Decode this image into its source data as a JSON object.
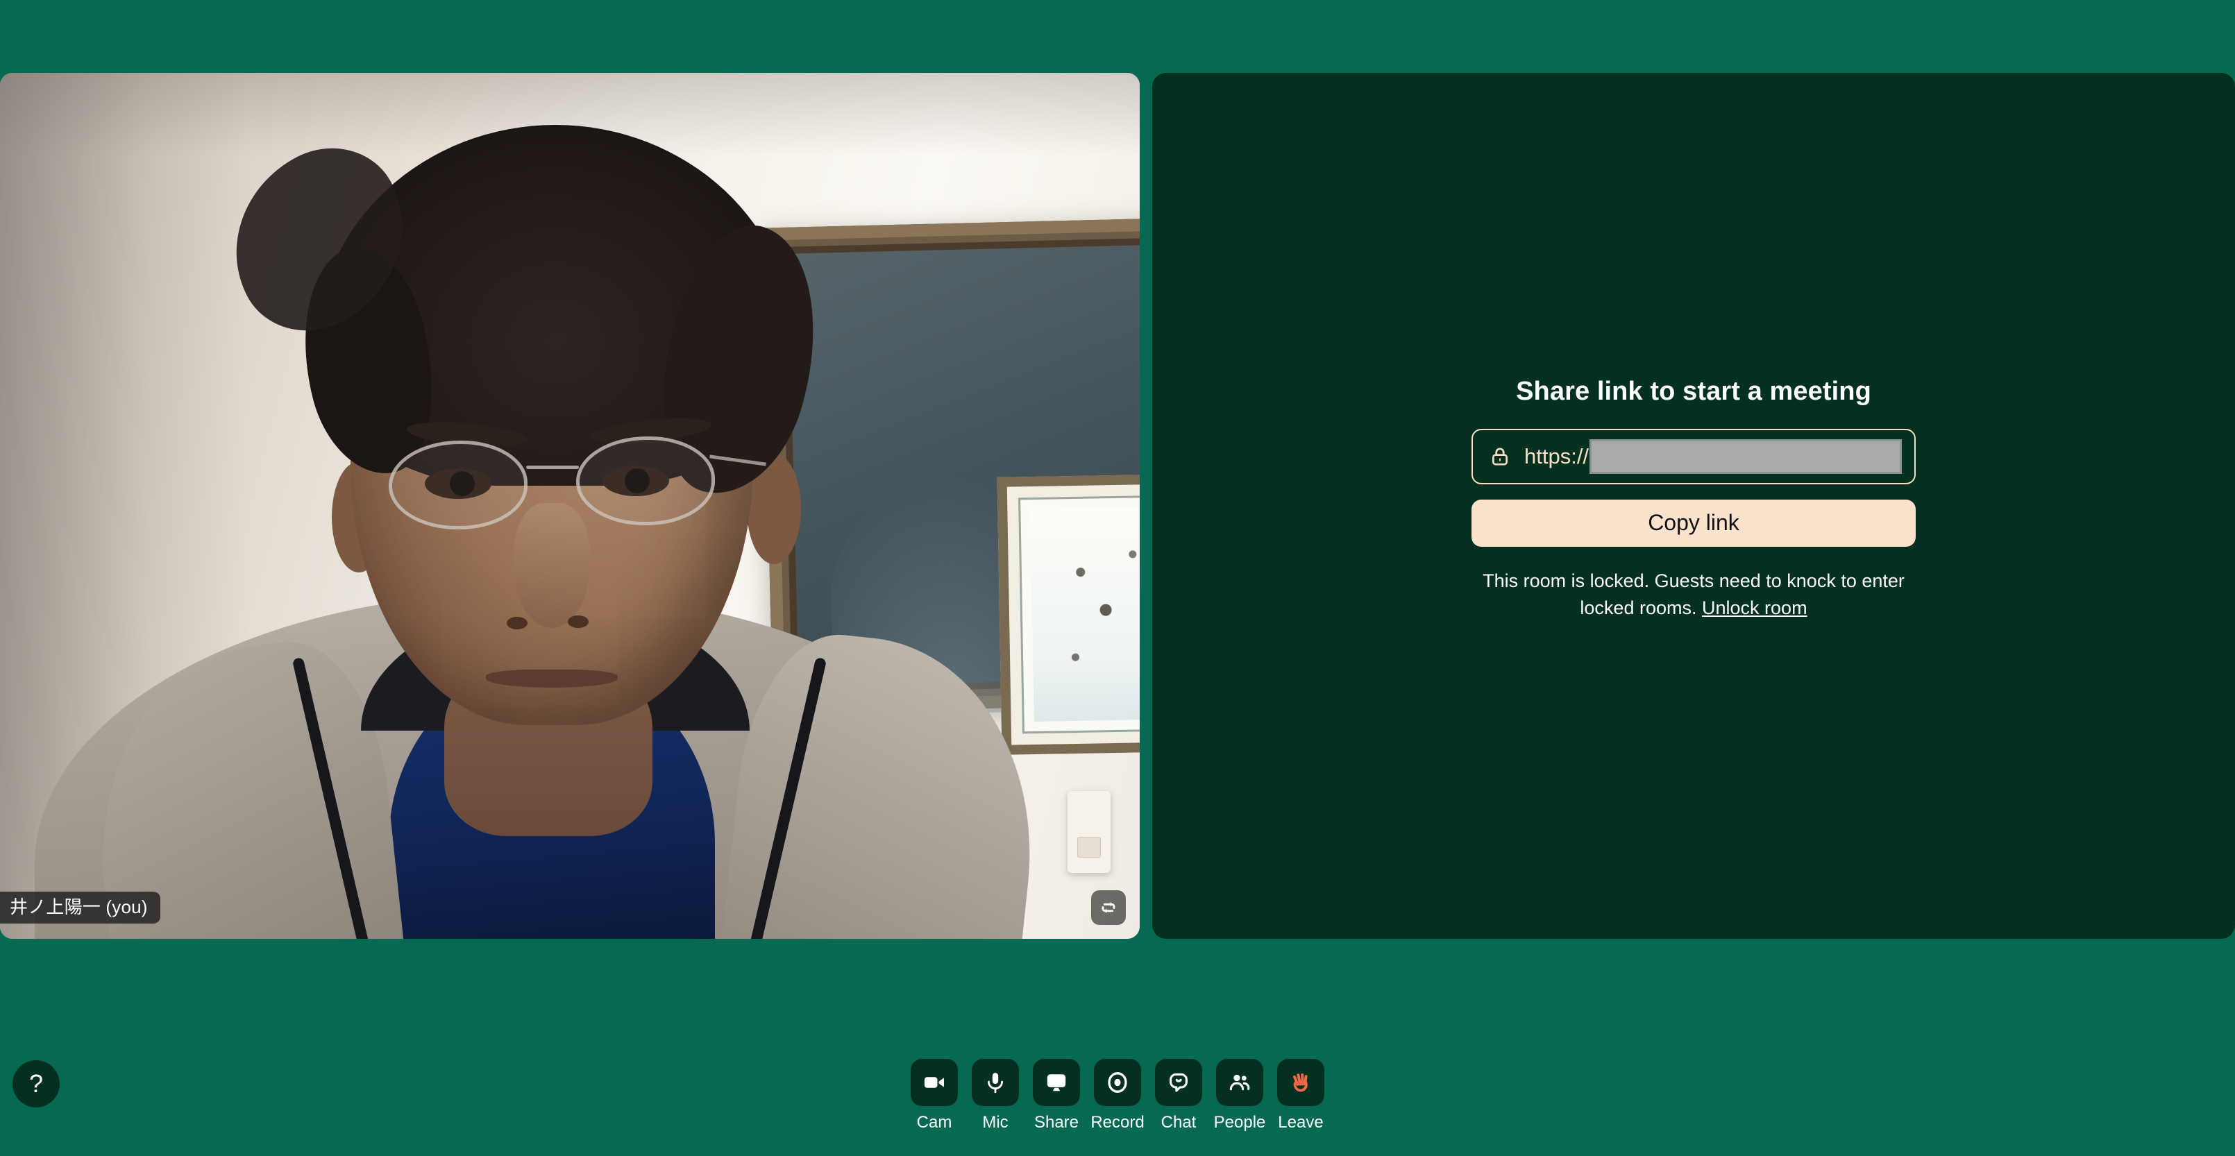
{
  "app": {
    "background_color": "#066a53",
    "panel_color": "#04301f",
    "accent_color": "#fae2cc",
    "leave_icon_color": "#f06848"
  },
  "video_tile": {
    "participant_name": "井ノ上陽一 (you)",
    "flip_camera_icon": "flip-camera-icon"
  },
  "share_panel": {
    "title": "Share link to start a meeting",
    "lock_icon": "lock-icon",
    "link_protocol": "https://",
    "link_value": "",
    "link_redacted": true,
    "copy_button_label": "Copy link",
    "lock_notice": "This room is locked. Guests need to knock to enter locked rooms.",
    "unlock_link_label": "Unlock room"
  },
  "bottom_bar": {
    "help_label": "?",
    "controls": [
      {
        "label": "Cam",
        "icon": "camera-icon"
      },
      {
        "label": "Mic",
        "icon": "microphone-icon"
      },
      {
        "label": "Share",
        "icon": "screen-share-icon"
      },
      {
        "label": "Record",
        "icon": "record-icon"
      },
      {
        "label": "Chat",
        "icon": "chat-bubble-icon"
      },
      {
        "label": "People",
        "icon": "people-icon"
      },
      {
        "label": "Leave",
        "icon": "waving-hand-icon"
      }
    ]
  }
}
